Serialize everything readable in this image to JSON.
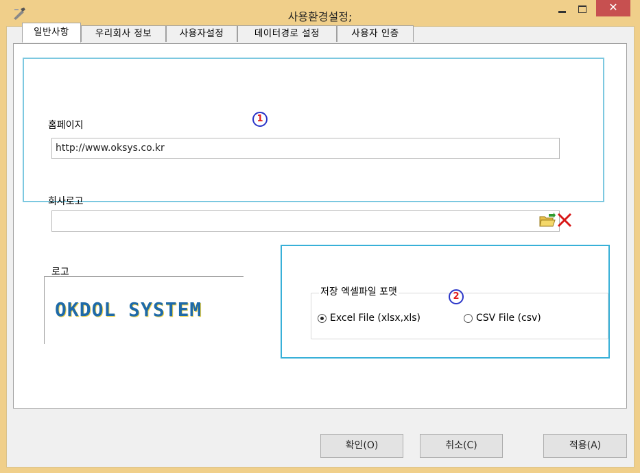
{
  "window": {
    "title": "사용환경설정;",
    "close_glyph": "✕"
  },
  "tabs": [
    {
      "label": "일반사항"
    },
    {
      "label": "우리회사 정보"
    },
    {
      "label": "사용자설정"
    },
    {
      "label": "데이터경로 설정"
    },
    {
      "label": "사용자 인증"
    }
  ],
  "markers": {
    "m1": "1",
    "m2": "2"
  },
  "homepage": {
    "label": "홈페이지",
    "value": "http://www.oksys.co.kr"
  },
  "company_logo": {
    "label": "회사로고",
    "value": ""
  },
  "logo_preview": {
    "label": "로고",
    "text": "OKDOL SYSTEM"
  },
  "excel_format": {
    "title": "저장 엑셀파일 포맷",
    "options": [
      {
        "label": "Excel File (xlsx,xls)",
        "selected": true
      },
      {
        "label": "CSV File (csv)",
        "selected": false
      }
    ]
  },
  "buttons": {
    "ok": "확인(O)",
    "cancel": "취소(C)",
    "apply": "적용(A)"
  },
  "colors": {
    "title_bar": "#f0cf8a",
    "close": "#c75050",
    "section_border": "#7cc8e0",
    "marker": "#2a35c8"
  },
  "icons": [
    "app-icon",
    "minimize-icon",
    "maximize-icon",
    "close-icon",
    "folder-open-icon",
    "delete-x-icon"
  ]
}
